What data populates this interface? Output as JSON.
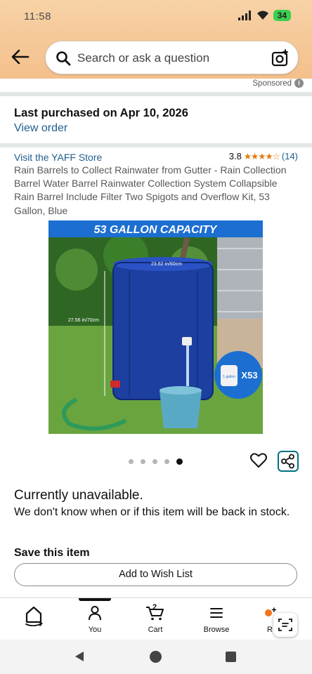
{
  "status_bar": {
    "time": "11:58",
    "battery": "34"
  },
  "search": {
    "placeholder": "Search or ask a question"
  },
  "sponsored": {
    "label": "Sponsored"
  },
  "order": {
    "last_purchased": "Last purchased on Apr 10, 2026",
    "view_order": "View order"
  },
  "product": {
    "store_link": "Visit the YAFF Store",
    "rating": "3.8",
    "stars": 3.8,
    "stars_display": "★★★★☆",
    "review_count": "(14)",
    "title": "Rain Barrels to Collect Rainwater from Gutter - Rain Collection Barrel Water Barrel Rainwater Collection System Collapsible Rain Barrel Include Filter Two Spigots and Overflow Kit, 53 Gallon, Blue",
    "image": {
      "banner": "53 GALLON CAPACITY",
      "width_label": "23.62 in/60cm",
      "height_label": "27.56 in/70cm",
      "jug_label": "1 gallon",
      "multiplier": "X53"
    },
    "carousel": {
      "count": 5,
      "active_index": 4
    }
  },
  "availability": {
    "status": "Currently unavailable.",
    "note": "We don't know when or if this item will be back in stock."
  },
  "save": {
    "title": "Save this item",
    "button": "Add to Wish List"
  },
  "bottom_nav": {
    "items": [
      {
        "label": "",
        "icon": "home-icon"
      },
      {
        "label": "You",
        "icon": "person-icon"
      },
      {
        "label": "Cart",
        "icon": "cart-icon",
        "count": "2"
      },
      {
        "label": "Browse",
        "icon": "menu-icon"
      },
      {
        "label": "R",
        "icon": "rufus-icon"
      }
    ]
  },
  "colors": {
    "header": "#f5c894",
    "link": "#1f5d8f",
    "star": "#e47911",
    "barrel": "#1c3fa0",
    "accent": "#007185"
  }
}
